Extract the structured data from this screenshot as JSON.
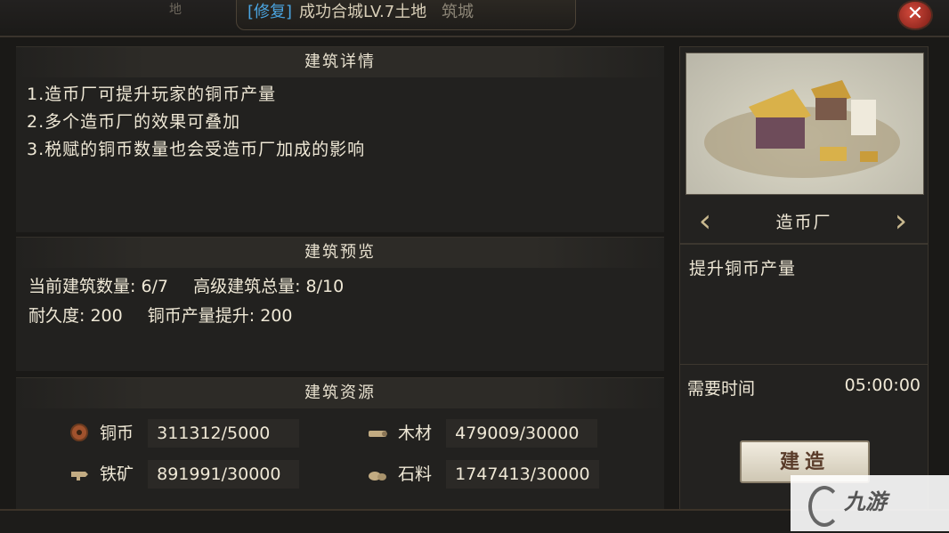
{
  "header": {
    "left_fragment": "地",
    "prefix": "[修复]",
    "title_text": "成功合城LV.7土地",
    "city_tab": "筑城",
    "close_label": "✕"
  },
  "details": {
    "heading": "建筑详情",
    "lines": [
      "1.造币厂可提升玩家的铜币产量",
      "2.多个造币厂的效果可叠加",
      "3.税赋的铜币数量也会受造币厂加成的影响"
    ]
  },
  "preview": {
    "heading": "建筑预览",
    "current_count": "当前建筑数量: 6/7",
    "advanced_total": "高级建筑总量: 8/10",
    "durability": "耐久度: 200",
    "copper_boost": "铜币产量提升: 200"
  },
  "resources": {
    "heading": "建筑资源",
    "items": [
      {
        "label": "铜币",
        "value": "311312/5000",
        "icon": "copper-coin-icon"
      },
      {
        "label": "木材",
        "value": "479009/30000",
        "icon": "wood-icon"
      },
      {
        "label": "铁矿",
        "value": "891991/30000",
        "icon": "iron-ore-icon"
      },
      {
        "label": "石料",
        "value": "1747413/30000",
        "icon": "stone-icon"
      }
    ]
  },
  "building": {
    "name": "造币厂",
    "effect": "提升铜币产量",
    "time_label": "需要时间",
    "time_value": "05:00:00",
    "build_button": "建造"
  },
  "watermark": {
    "text": "九游"
  }
}
